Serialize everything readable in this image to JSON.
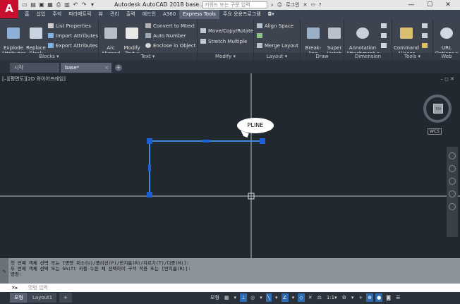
{
  "app": {
    "logo": "A",
    "title": "Autodesk AutoCAD 2018    base...",
    "search_placeholder": "키워드 또는 구문 입력",
    "user": "로그인",
    "help": "?"
  },
  "menu_tabs": [
    "홈",
    "삽입",
    "주석",
    "파라메트릭",
    "뷰",
    "관리",
    "출력",
    "애드인",
    "A360",
    "Express Tools",
    "주요 응용프로그램",
    "◘▾"
  ],
  "active_menu_tab": "Express Tools",
  "ribbon": {
    "blocks": {
      "footer": "Blocks ▾",
      "explode": "Explode\nAttributes",
      "replace": "Replace\nBlock",
      "list_props": "List Properties",
      "import_attr": "Import Attributes",
      "export_attr": "Export Attributes"
    },
    "text": {
      "footer": "Text ▾",
      "arc": "Arc\nAligned",
      "modify": "Modify\nText ▾",
      "convert": "Convert to Mtext",
      "auto_number": "Auto Number",
      "enclose": "Enclose in Object"
    },
    "modify": {
      "footer": "Modify ▾",
      "move_copy": "Move/Copy/Rotate",
      "stretch": "Stretch Multiple"
    },
    "layout": {
      "footer": "Layout ▾",
      "align_space": "Align Space",
      "merge_layout": "Merge Layout"
    },
    "draw": {
      "footer": "Draw",
      "break_line": "Break-line\nSymbol",
      "super_hatch": "Super\nHatch"
    },
    "dimension": {
      "footer": "Dimension",
      "annotation": "Annotation\nAttachment ▾"
    },
    "tools": {
      "footer": "Tools ▾",
      "command_aliases": "Command\nAliases"
    },
    "web": {
      "footer": "Web",
      "url_options": "URL\nOptions ▾"
    }
  },
  "doc_tabs": [
    {
      "label": "시작"
    },
    {
      "label": "base*"
    }
  ],
  "viewport": {
    "label": "[–][평면도][2D 와이어프레임]",
    "controls": "– ◻ ✕",
    "viewcube_face": "TOP",
    "wcs": "WCS",
    "tooltip": "PLINE"
  },
  "command": {
    "history_1": "첫 번째 객체 선택 또는 [명령 취소(U)/폴리선(P)/반지름(R)/자르기(T)/다중(M)]:",
    "history_2": "두 번째 객체 선택 또는 Shift 키를 누른 채 선택하여 구석 적용 또는 [반지름(R)]:",
    "history_3": "명령:",
    "input_placeholder": "명령 입력"
  },
  "status": {
    "tabs": [
      "모형",
      "Layout1",
      "+"
    ],
    "items": [
      "모형",
      "▦",
      "▾",
      "⊥",
      "◎",
      "▾",
      "╲",
      "▾",
      "∠",
      "▾",
      "◇",
      "✕",
      "⚖",
      "1:1▾",
      "⚙",
      "▾",
      "+",
      "⊕",
      "●",
      "◙",
      "☰"
    ]
  },
  "colors": {
    "accent": "#c8102e",
    "polyline": "#3a8ee6",
    "grip": "#1e5fd6",
    "canvas": "#212830"
  }
}
